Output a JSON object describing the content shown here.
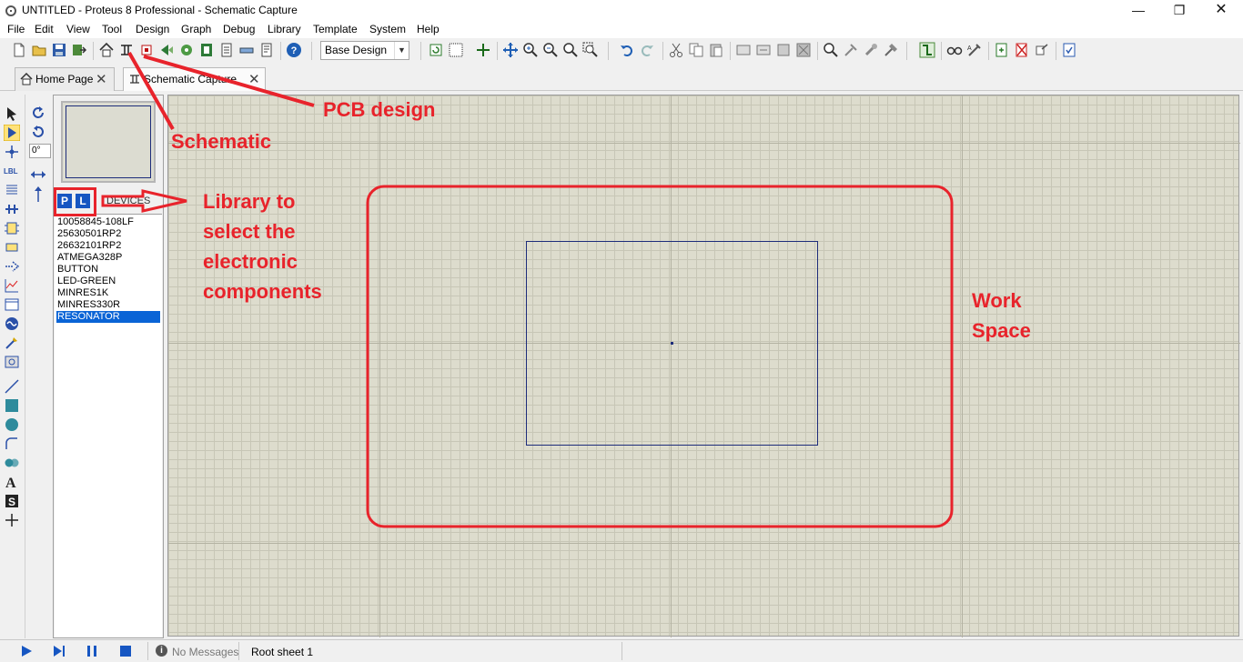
{
  "window": {
    "title": "UNTITLED - Proteus 8 Professional - Schematic Capture",
    "minimize": "—",
    "maximize": "❐",
    "close": "✕"
  },
  "menu": [
    "File",
    "Edit",
    "View",
    "Tool",
    "Design",
    "Graph",
    "Debug",
    "Library",
    "Template",
    "System",
    "Help"
  ],
  "toolbar": {
    "variant_select": "Base Design"
  },
  "tabs": [
    {
      "label": "Home Page",
      "active": false
    },
    {
      "label": "Schematic Capture",
      "active": true
    }
  ],
  "selector": {
    "pick_button": "P",
    "library_button": "L",
    "devices_label": "DEVICES",
    "devices": [
      "10058845-108LF",
      "25630501RP2",
      "26632101RP2",
      "ATMEGA328P",
      "BUTTON",
      "LED-GREEN",
      "MINRES1K",
      "MINRES330R",
      "RESONATOR"
    ],
    "selected_device": "RESONATOR"
  },
  "rotation": {
    "angle": "0°"
  },
  "status": {
    "messages": "No Messages",
    "sheet": "Root sheet 1"
  },
  "annotations": {
    "pcb": "PCB design",
    "schematic": "Schematic",
    "library_lines": [
      "Library to",
      "select the",
      "electronic",
      "components"
    ],
    "workspace_lines": [
      "Work",
      "Space"
    ]
  },
  "colors": {
    "annotation": "#e8232b",
    "grid_bg": "#dddccd",
    "sheet_border": "#1d2c7a",
    "selection": "#0a64d6",
    "pl_button": "#1656c2"
  }
}
